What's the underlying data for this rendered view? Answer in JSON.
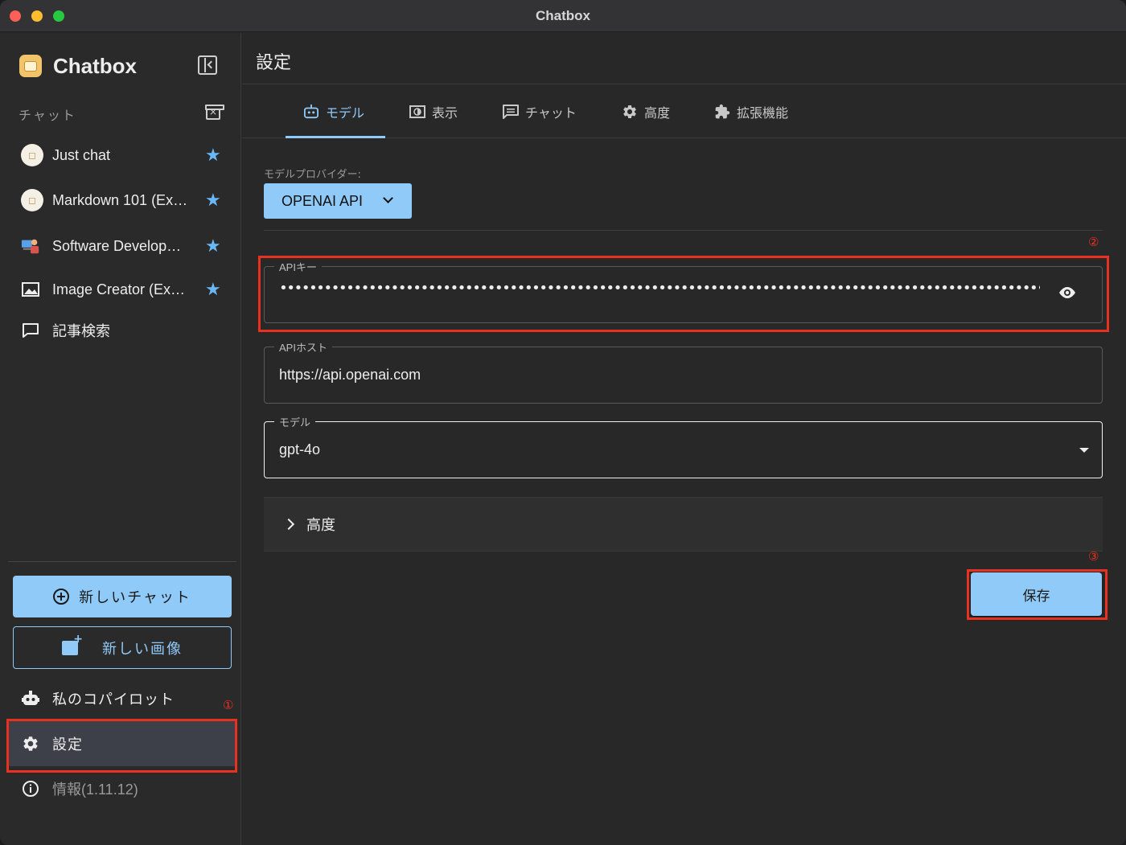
{
  "window": {
    "title": "Chatbox"
  },
  "sidebar": {
    "brand": "Chatbox",
    "section_label": "チャット",
    "sessions": [
      {
        "label": "Just chat",
        "icon": "chatbox-avatar-icon",
        "starred": true
      },
      {
        "label": "Markdown 101 (Ex…",
        "icon": "chatbox-avatar-icon",
        "starred": true
      },
      {
        "label": "Software Develop…",
        "icon": "developer-avatar-icon",
        "starred": true
      },
      {
        "label": "Image Creator (Ex…",
        "icon": "image-icon",
        "starred": true
      },
      {
        "label": "記事検索",
        "icon": "chat-bubble-icon",
        "starred": false
      }
    ],
    "new_chat_label": "新しいチャット",
    "new_image_label": "新しい画像",
    "copilot_label": "私のコパイロット",
    "settings_label": "設定",
    "about_label": "情報(1.11.12)"
  },
  "main": {
    "title": "設定",
    "tabs": [
      {
        "label": "モデル",
        "icon": "robot-icon",
        "active": true
      },
      {
        "label": "表示",
        "icon": "display-icon",
        "active": false
      },
      {
        "label": "チャット",
        "icon": "message-icon",
        "active": false
      },
      {
        "label": "高度",
        "icon": "gear-icon",
        "active": false
      },
      {
        "label": "拡張機能",
        "icon": "puzzle-icon",
        "active": false
      }
    ],
    "provider_label": "モデルプロバイダー:",
    "provider_value": "OPENAI API",
    "api_key": {
      "label": "APIキー",
      "value": "••••••••••••••••••••••••••••••••••••••••••••••••••••••••••••••••••••••••••••••••••••••••••••••••••••••••••••••••••••••••••••••••••••••••••••••••••••••••••••••••••••"
    },
    "api_host": {
      "label": "APIホスト",
      "value": "https://api.openai.com"
    },
    "model": {
      "label": "モデル",
      "value": "gpt-4o"
    },
    "advanced_label": "高度",
    "save_label": "保存"
  },
  "annotations": {
    "one": "①",
    "two": "②",
    "three": "③"
  },
  "colors": {
    "accent": "#90caf9",
    "annotation": "#e8321f",
    "star": "#6ab7f5"
  }
}
